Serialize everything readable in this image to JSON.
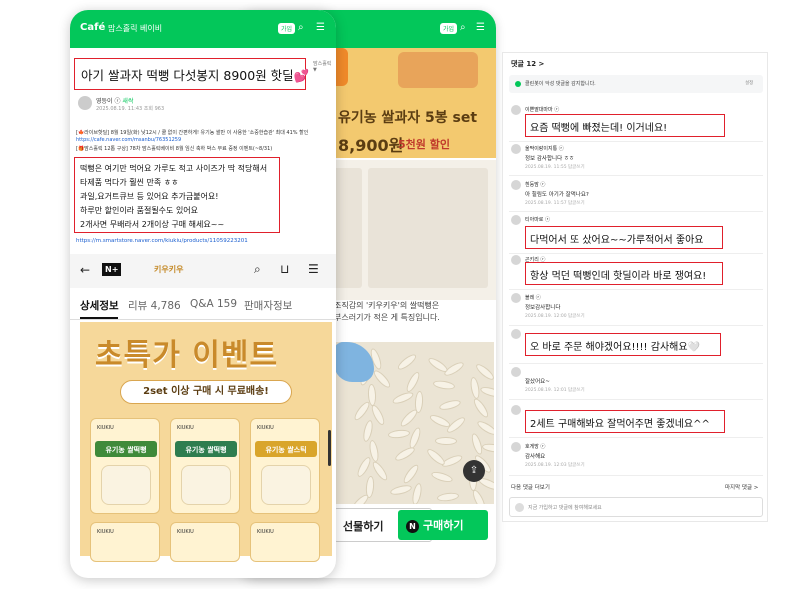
{
  "cafe": {
    "logo": "Café",
    "name": "맘스홀릭 베이비",
    "join_label": "가입",
    "search_icon": "search-icon",
    "menu_icon": "menu-icon"
  },
  "post": {
    "title": "아기 쌀과자 떡뻥 다섯봉지 8900원 핫딜💕",
    "tag": "맘스홀릭 ▼",
    "author": "영등이 ⓡ",
    "author_level": "새싹",
    "meta": "2025.08.19. 11:43  조회 963",
    "intro_lines": [
      "[🍁라이브핫딜] 8월 19일(화) 낮12시 / 쿨 없이 간편하게! 유기농 쌀만 이 사용한 '소중한습관' 최대 41% 할인",
      "https://cafe.naver.com/msanbu/76351259",
      "[🎁맘스홀릭 12톱 구상] 78차 맘스홀릭베이비 8월 임신 축하 박스 무료 증정 이벤트(~8/31)"
    ],
    "body_lines": [
      "떡뻥은 여기만 먹어요 가루도 적고 사이즈가 딱 적당해서",
      "타제품 먹다가 훨씬 만족 ㅎㅎ",
      "과일,요거트큐브 등 있어요 추가금붙어요!",
      "하루만 할인이라 품절될수도 있어요",
      "2개사면 무배라서 2개이상 구매 해세요~~"
    ],
    "store_link": "https://m.smartstore.naver.com/kiukiu/products/11059223201"
  },
  "store": {
    "nplus": "N+",
    "brand": "키우키우",
    "tabs": [
      "상세정보",
      "리뷰 4,786",
      "Q&A 159",
      "판매자정보"
    ],
    "active_tab": 0,
    "event_title": "초특가 이벤트",
    "event_pill": "2set 이상 구매 시 무료배송!",
    "products": [
      "유기농 쌀떡뻥",
      "유기농 쌀떡뻥",
      "유기농 쌀스틱"
    ],
    "product_brand": "KIUKIU",
    "product_colors": [
      "#3f8a3a",
      "#2e7d4f",
      "#d9a52b"
    ]
  },
  "product_detail": {
    "title": "유기농 쌀과자 5봉 set",
    "price": "8,900원",
    "discount": "5천원 할인",
    "desc_line1": "조직감의 '키우키우'의 쌀떡뻥은",
    "desc_line2": "부스러기가 적은 게 특징입니다.",
    "gift_label": "선물하기",
    "buy_label": "구매하기",
    "buy_badge": "N"
  },
  "comments": {
    "count_label": "댓글 12 >",
    "notice": "클린봇이 악성 댓글을 감지합니다.",
    "notice_setting": "설정",
    "items": [
      {
        "name": "이쁜딸대마마 ⓡ",
        "text": "요즘 떡뻥에 빠졌는데! 이거네요!",
        "meta": "",
        "boxed": true
      },
      {
        "name": "울딱이랑이지통 ⓡ",
        "text": "정보 감사합니다 ㅎㅎ",
        "meta": "2025.08.19. 11:55  답글쓰기",
        "boxed": false
      },
      {
        "name": "흰둥맘 ⓡ",
        "text": "아 힐림도 아기가 잘먹나요?",
        "meta": "2025.08.19. 11:57  답글쓰기",
        "boxed": false
      },
      {
        "name": "티아마로 ⓡ",
        "text": "다먹어서 또 샀어요~~가루적어서 좋아요",
        "meta": "",
        "boxed": true
      },
      {
        "name": "곤키리 ⓡ",
        "text": "항상 먹던 떡뻥인데 핫딜이라 바로 쟁여요!",
        "meta": "",
        "boxed": true
      },
      {
        "name": "블레 ⓡ",
        "text": "정보감사합니다",
        "meta": "2025.08.19. 12:00  답글쓰기",
        "boxed": false
      },
      {
        "name": "",
        "text": "오 바로 주문 해야겠어요!!!! 감사해요🤍",
        "meta": "",
        "boxed": true
      },
      {
        "name": "",
        "text": "잘샀어요~",
        "meta": "2025.08.19. 12:01  답글쓰기",
        "boxed": false
      },
      {
        "name": "",
        "text": "2세트 구매해봐요 잘먹어주면 좋겠네요^^",
        "meta": "",
        "boxed": true
      },
      {
        "name": "호게방 ⓡ",
        "text": "감사해요",
        "meta": "2025.08.19. 12:03  답글쓰기",
        "boxed": false
      }
    ],
    "more_label": "다음 댓글 더보기",
    "last_label": "마지막 댓글 >",
    "join_placeholder": "지금 가입하고 댓글에 참여해보세요"
  },
  "colors": {
    "naver_green": "#03c75a",
    "highlight_red": "#e0202c",
    "banner_yellow": "#f6d89a"
  }
}
